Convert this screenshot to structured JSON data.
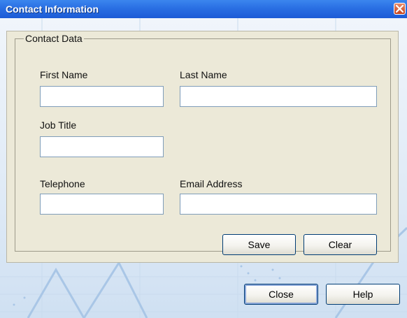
{
  "window": {
    "title": "Contact Information"
  },
  "group": {
    "legend": "Contact Data"
  },
  "fields": {
    "first_name": {
      "label": "First Name",
      "value": ""
    },
    "last_name": {
      "label": "Last Name",
      "value": ""
    },
    "job_title": {
      "label": "Job Title",
      "value": ""
    },
    "telephone": {
      "label": "Telephone",
      "value": ""
    },
    "email": {
      "label": "Email Address",
      "value": ""
    }
  },
  "buttons": {
    "save": "Save",
    "clear": "Clear",
    "close": "Close",
    "help": "Help"
  },
  "icons": {
    "title_close": "close-icon"
  },
  "colors": {
    "title_bar": "#2a6fe3",
    "close_button": "#c4431d",
    "panel": "#ece9d8"
  }
}
